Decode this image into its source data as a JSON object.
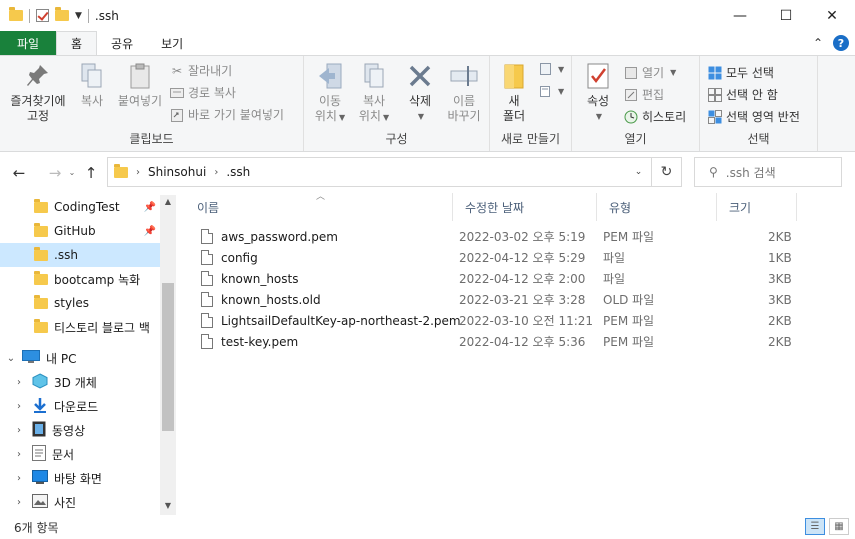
{
  "window": {
    "title": ".ssh",
    "minimize": "—",
    "maximize": "☐",
    "close": "✕"
  },
  "tabs": [
    "파일",
    "홈",
    "공유",
    "보기"
  ],
  "ribbon": {
    "clipboard": {
      "label": "클립보드",
      "pin_line1": "즐겨찾기에",
      "pin_line2": "고정",
      "copy": "복사",
      "paste": "붙여넣기",
      "cut": "잘라내기",
      "copy_path": "경로 복사",
      "paste_shortcut": "바로 가기 붙여넣기"
    },
    "organize": {
      "label": "구성",
      "move_line1": "이동",
      "move_line2": "위치",
      "copy_line1": "복사",
      "copy_line2": "위치",
      "delete": "삭제",
      "rename_line1": "이름",
      "rename_line2": "바꾸기"
    },
    "new": {
      "label": "새로 만들기",
      "folder_line1": "새",
      "folder_line2": "폴더"
    },
    "open": {
      "label": "열기",
      "properties": "속성",
      "open": "열기",
      "edit": "편집",
      "history": "히스토리"
    },
    "select": {
      "label": "선택",
      "select_all": "모두 선택",
      "select_none": "선택 안 함",
      "invert": "선택 영역 반전"
    }
  },
  "address": {
    "crumbs": [
      "Shinsohui",
      ".ssh"
    ],
    "search_placeholder": ".ssh 검색"
  },
  "nav": {
    "quick": [
      "CodingTest",
      "GitHub",
      ".ssh",
      "bootcamp 녹화",
      "styles",
      "티스토리 블로그 백"
    ],
    "this_pc": "내 PC",
    "pc_items": [
      "3D 개체",
      "다운로드",
      "동영상",
      "문서",
      "바탕 화면",
      "사진"
    ]
  },
  "columns": {
    "name": "이름",
    "modified": "수정한 날짜",
    "type": "유형",
    "size": "크기"
  },
  "files": [
    {
      "name": "aws_password.pem",
      "modified": "2022-03-02 오후 5:19",
      "type": "PEM 파일",
      "size": "2KB"
    },
    {
      "name": "config",
      "modified": "2022-04-12 오후 5:29",
      "type": "파일",
      "size": "1KB"
    },
    {
      "name": "known_hosts",
      "modified": "2022-04-12 오후 2:00",
      "type": "파일",
      "size": "3KB"
    },
    {
      "name": "known_hosts.old",
      "modified": "2022-03-21 오후 3:28",
      "type": "OLD 파일",
      "size": "3KB"
    },
    {
      "name": "LightsailDefaultKey-ap-northeast-2.pem",
      "modified": "2022-03-10 오전 11:21",
      "type": "PEM 파일",
      "size": "2KB"
    },
    {
      "name": "test-key.pem",
      "modified": "2022-04-12 오후 5:36",
      "type": "PEM 파일",
      "size": "2KB"
    }
  ],
  "status": {
    "count": "6개 항목"
  },
  "colors": {
    "file_tab": "#19813b",
    "selection": "#cce8ff",
    "accent": "#1a6ec7"
  }
}
